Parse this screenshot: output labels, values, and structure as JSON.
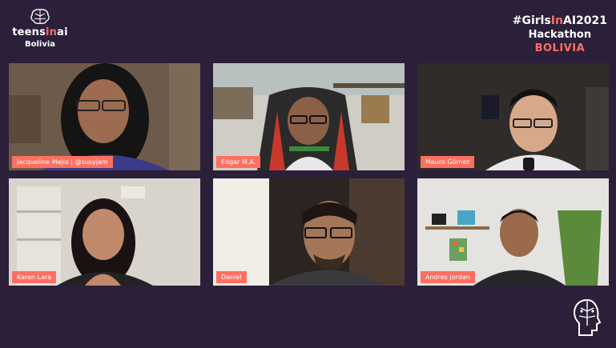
{
  "logo": {
    "brand_prefix": "teens",
    "brand_accent": "in",
    "brand_suffix": "ai",
    "subtitle": "Bolivia"
  },
  "event": {
    "hashtag_prefix": "#Girls",
    "hashtag_accent": "In",
    "hashtag_suffix": "AI2021",
    "title": "Hackathon",
    "country": "BOLIVIA"
  },
  "participants": [
    {
      "name": "Jacqueline Mejia | @susyjam"
    },
    {
      "name": "Edgar M.A."
    },
    {
      "name": "Mauro Gómez"
    },
    {
      "name": "Karen Lara"
    },
    {
      "name": "Daniel"
    },
    {
      "name": "Andres Jordan"
    }
  ],
  "colors": {
    "background": "#2b1f3a",
    "accent": "#ff6f61"
  }
}
